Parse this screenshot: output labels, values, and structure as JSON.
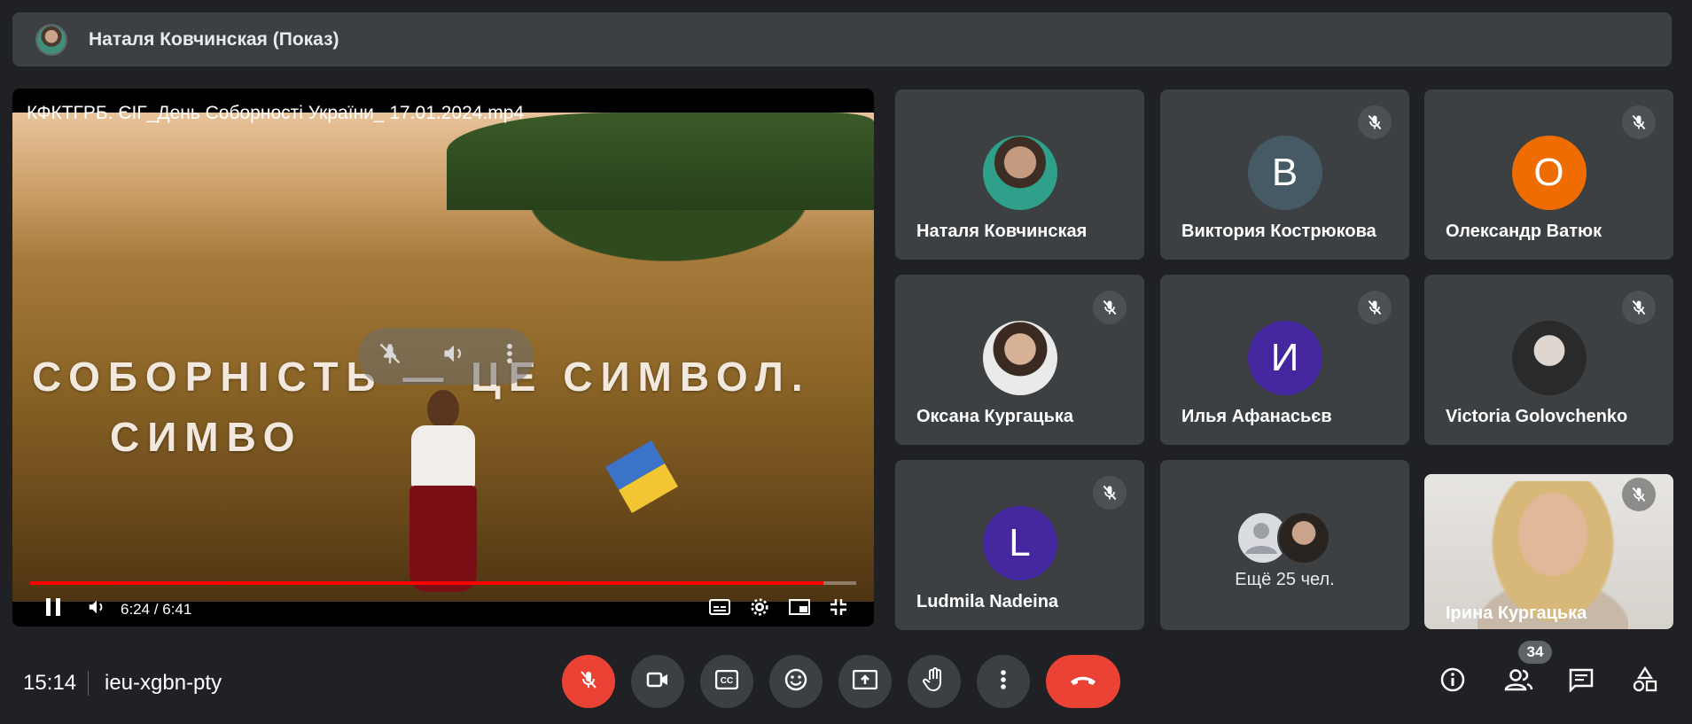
{
  "presenter": {
    "name": "Наталя Ковчинская (Показ)"
  },
  "video": {
    "file_title": "КФКТГРБ. ЄІГ_День Соборності України_ 17.01.2024.mp4",
    "overlay_line1": "СОБОРНІСТЬ — ЦЕ СИМВОЛ.",
    "overlay_line2": "СИМВО",
    "time": "6:24 / 6:41",
    "progress": 0.96
  },
  "participants": [
    {
      "name": "Наталя Ковчинская",
      "initial": "",
      "avatar_color": "",
      "muted": false
    },
    {
      "name": "Виктория Кострюкова",
      "initial": "В",
      "avatar_color": "#455a64",
      "muted": true
    },
    {
      "name": "Олександр Ватюк",
      "initial": "О",
      "avatar_color": "#ef6c00",
      "muted": true
    },
    {
      "name": "Оксана Кургацька",
      "initial": "",
      "avatar_color": "",
      "muted": true
    },
    {
      "name": "Илья Афанасьєв",
      "initial": "И",
      "avatar_color": "#4527a0",
      "muted": true
    },
    {
      "name": "Victoria Golovchenko",
      "initial": "",
      "avatar_color": "",
      "muted": true
    },
    {
      "name": "Ludmila Nadeina",
      "initial": "L",
      "avatar_color": "#4527a0",
      "muted": true
    },
    {
      "name": "Ірина Кургацька",
      "initial": "",
      "avatar_color": "",
      "muted": true
    }
  ],
  "more_tile": {
    "label": "Ещё 25 чел."
  },
  "bottom": {
    "clock": "15:14",
    "meeting_code": "ieu-xgbn-pty",
    "people_count": "34"
  },
  "colors": {
    "background": "#202124",
    "tile": "#3c4043",
    "danger": "#ea4335"
  }
}
